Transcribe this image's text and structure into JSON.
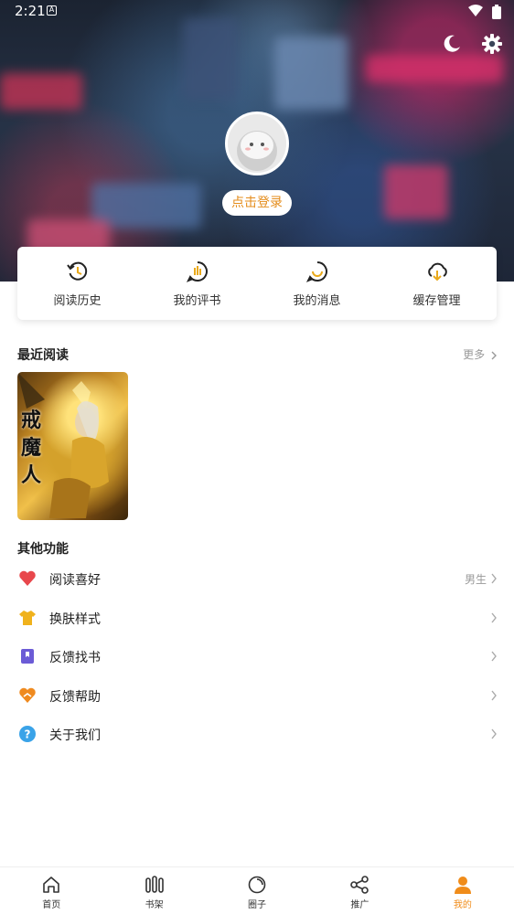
{
  "status_bar": {
    "time": "2:21",
    "notification_icon": "a-icon"
  },
  "header": {
    "login_label": "点击登录"
  },
  "quick_actions": [
    {
      "label": "阅读历史",
      "icon": "history-icon"
    },
    {
      "label": "我的评书",
      "icon": "review-icon"
    },
    {
      "label": "我的消息",
      "icon": "message-icon"
    },
    {
      "label": "缓存管理",
      "icon": "download-cloud-icon"
    }
  ],
  "recent": {
    "title": "最近阅读",
    "more_label": "更多",
    "book_cover_text": "戒魔人"
  },
  "other": {
    "title": "其他功能",
    "items": [
      {
        "label": "阅读喜好",
        "value": "男生",
        "icon": "heart-icon"
      },
      {
        "label": "换肤样式",
        "value": "",
        "icon": "shirt-icon"
      },
      {
        "label": "反馈找书",
        "value": "",
        "icon": "book-icon"
      },
      {
        "label": "反馈帮助",
        "value": "",
        "icon": "help-heart-icon"
      },
      {
        "label": "关于我们",
        "value": "",
        "icon": "question-icon"
      }
    ]
  },
  "nav": [
    {
      "label": "首页",
      "icon": "home-icon"
    },
    {
      "label": "书架",
      "icon": "bookshelf-icon"
    },
    {
      "label": "圈子",
      "icon": "circle-icon"
    },
    {
      "label": "推广",
      "icon": "share-icon"
    },
    {
      "label": "我的",
      "icon": "user-icon"
    }
  ],
  "colors": {
    "accent": "#f08c1a",
    "login_text": "#e48c1b",
    "icon_gold": "#e9a91a"
  }
}
